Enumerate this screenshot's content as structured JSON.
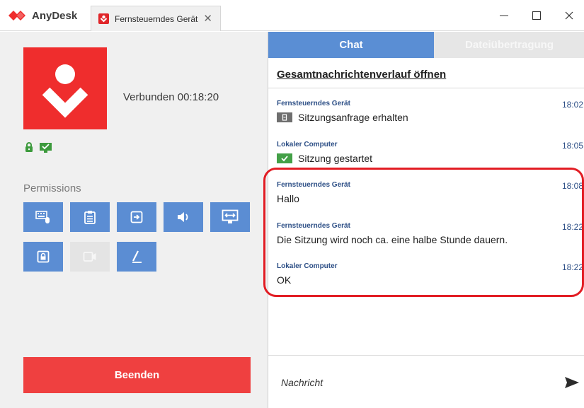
{
  "app": {
    "name": "AnyDesk"
  },
  "tab": {
    "label": "Fernsteuerndes Gerät"
  },
  "window": {
    "minimize": "—",
    "maximize": "☐",
    "close": "✕"
  },
  "session": {
    "status": "Verbunden 00:18:20"
  },
  "permissions": {
    "title": "Permissions",
    "items": [
      {
        "icon": "keyboard-mouse-icon",
        "enabled": true
      },
      {
        "icon": "clipboard-icon",
        "enabled": true
      },
      {
        "icon": "file-transfer-icon",
        "enabled": true
      },
      {
        "icon": "sound-icon",
        "enabled": true
      },
      {
        "icon": "switch-sides-icon",
        "enabled": true
      },
      {
        "icon": "lock-screen-icon",
        "enabled": true
      },
      {
        "icon": "record-icon",
        "enabled": false
      },
      {
        "icon": "draw-icon",
        "enabled": true
      }
    ]
  },
  "end_button": {
    "label": "Beenden"
  },
  "chat": {
    "tabs": [
      {
        "label": "Chat",
        "active": true
      },
      {
        "label": "Dateiübertragung",
        "active": false
      }
    ],
    "history_link": "Gesamtnachrichtenverlauf öffnen",
    "messages": [
      {
        "sender": "Fernsteuerndes Gerät",
        "time": "18:02",
        "text": "Sitzungsanfrage erhalten",
        "icon": "session-request-icon"
      },
      {
        "sender": "Lokaler Computer",
        "time": "18:05",
        "text": "Sitzung gestartet",
        "icon": "session-started-icon"
      },
      {
        "sender": "Fernsteuerndes Gerät",
        "time": "18:08",
        "text": "Hallo"
      },
      {
        "sender": "Fernsteuerndes Gerät",
        "time": "18:22",
        "text": "Die Sitzung wird noch ca. eine halbe Stunde dauern."
      },
      {
        "sender": "Lokaler Computer",
        "time": "18:22",
        "text": "OK"
      }
    ],
    "input_placeholder": "Nachricht"
  },
  "colors": {
    "brand_red": "#ef2d2d",
    "accent_blue": "#5a8ed4",
    "highlight_red": "#e21d24",
    "sender_blue": "#2d4f86"
  }
}
